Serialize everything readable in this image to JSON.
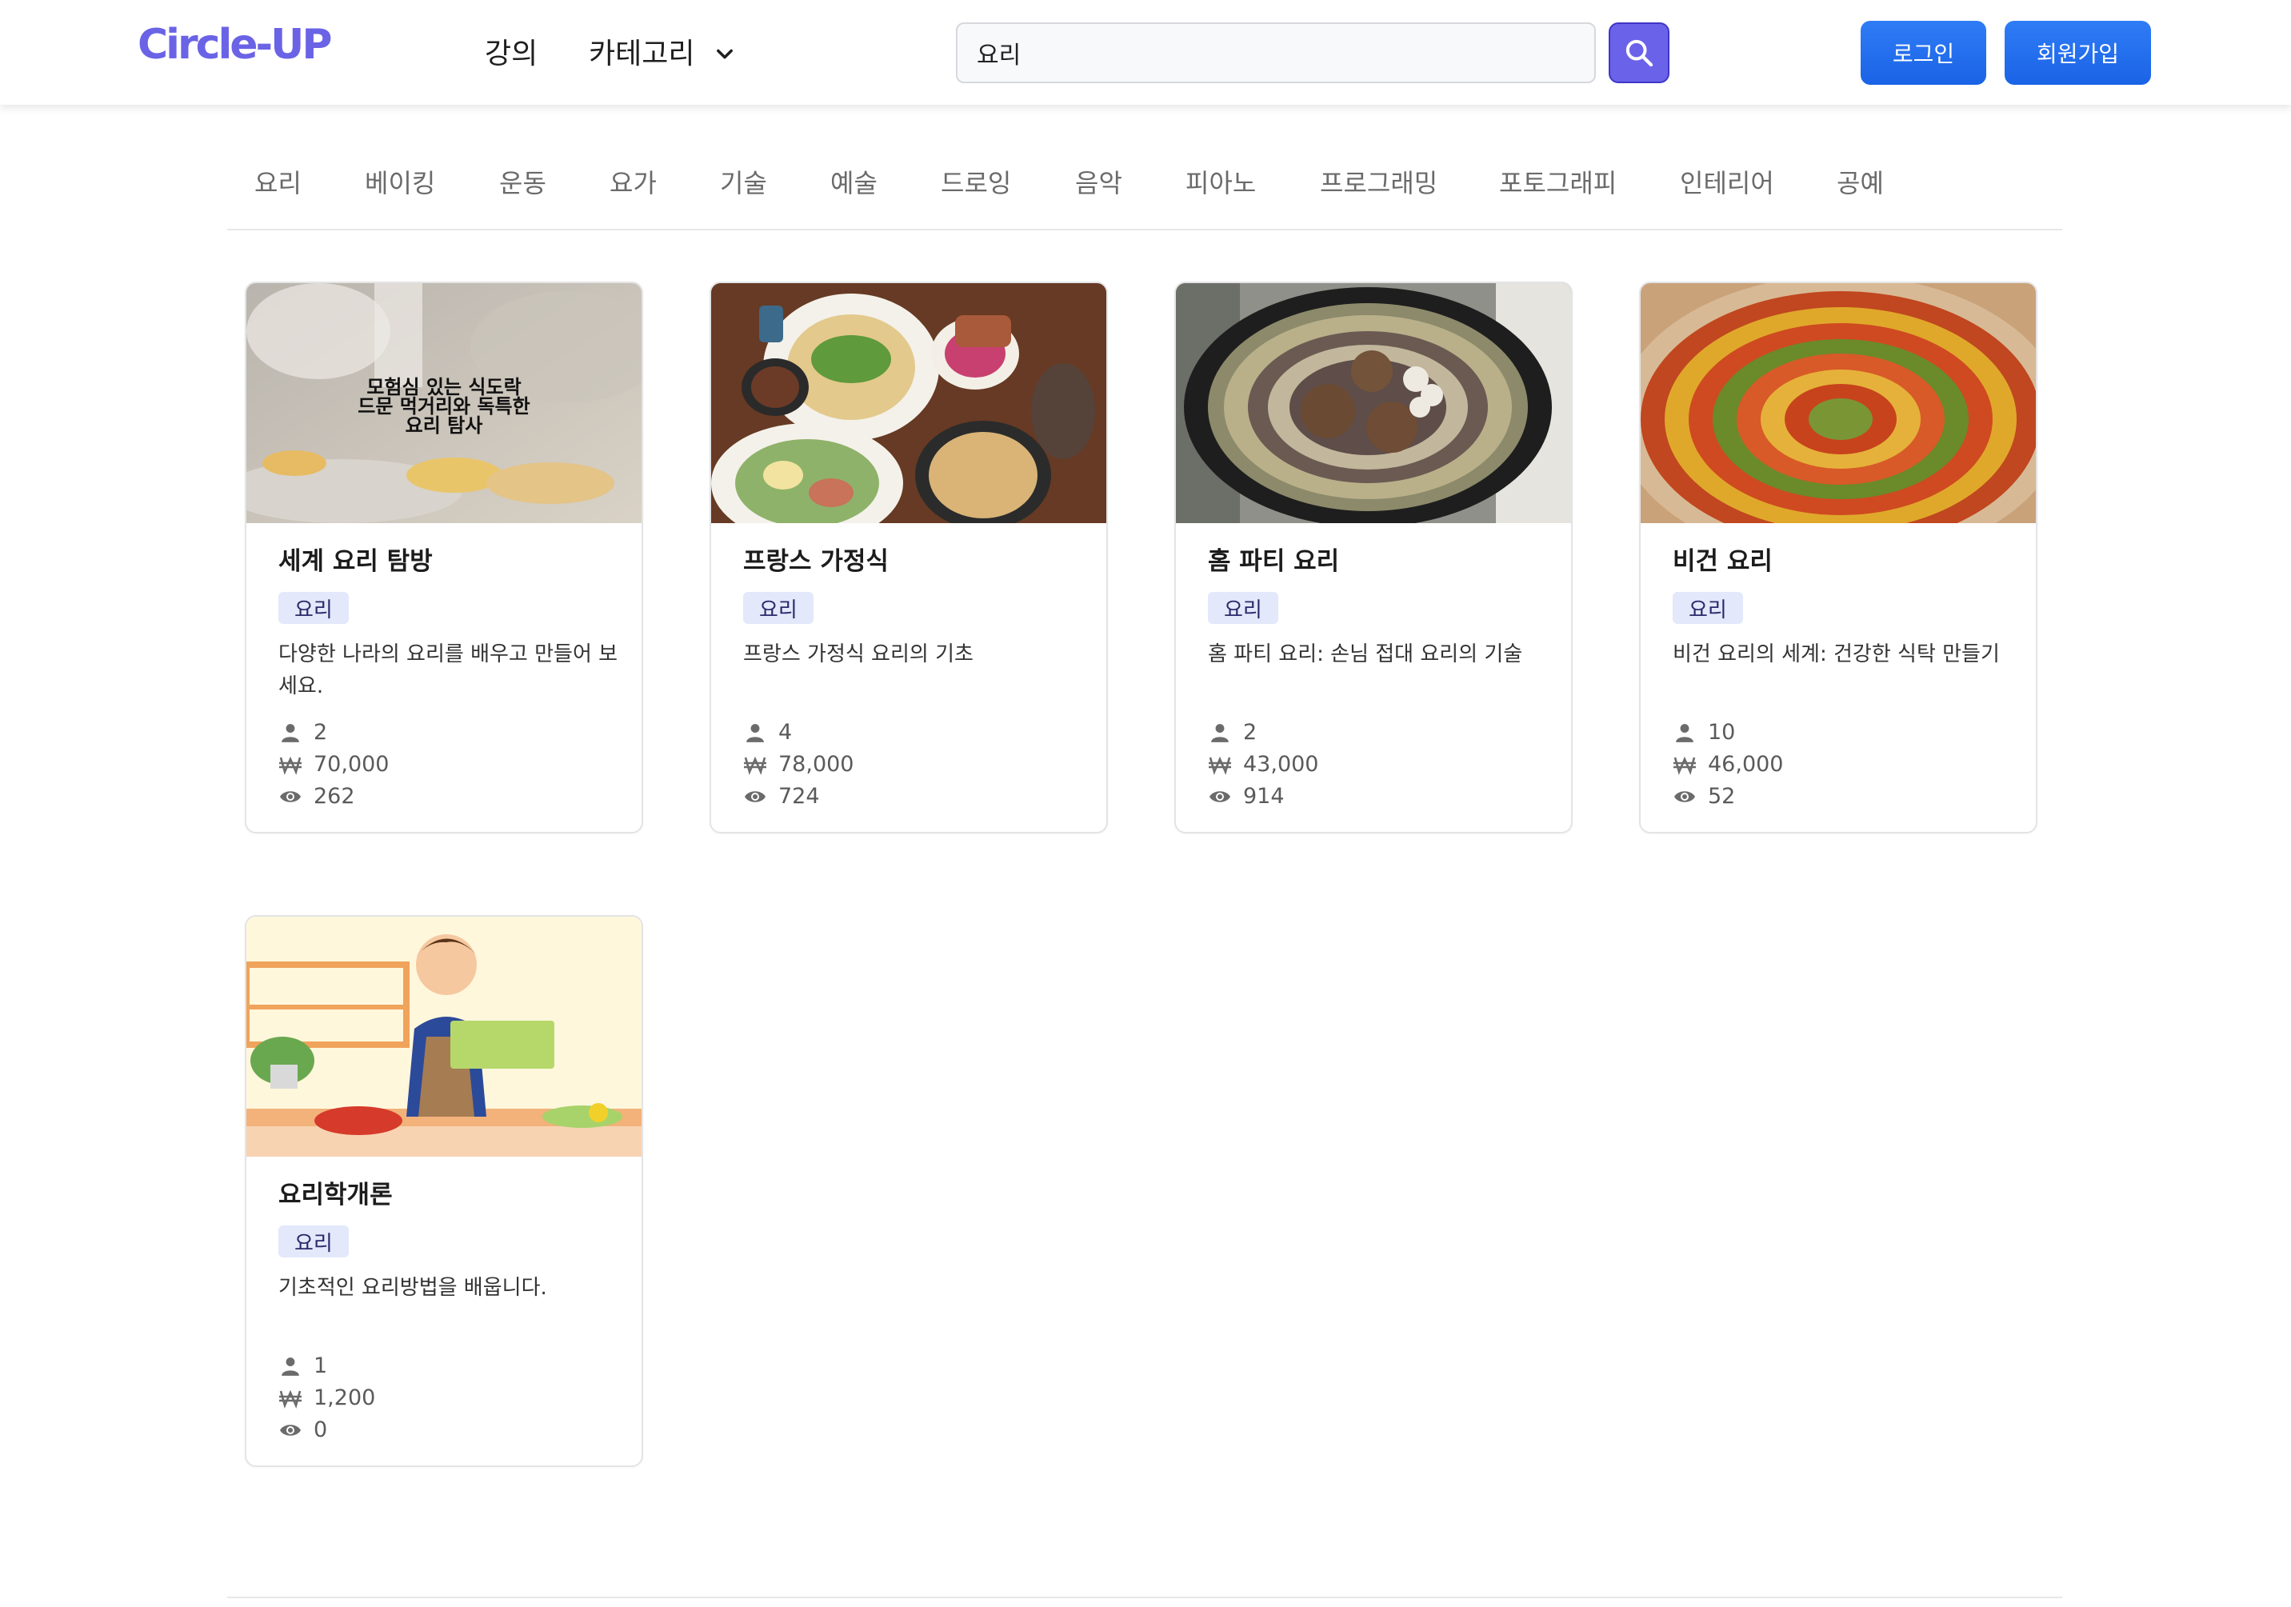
{
  "header": {
    "logo": "Circle-UP",
    "nav": {
      "lecture": "강의",
      "category": "카테고리"
    },
    "search": {
      "value": "요리"
    },
    "login": "로그인",
    "signup": "회원가입"
  },
  "categories": [
    "요리",
    "베이킹",
    "운동",
    "요가",
    "기술",
    "예술",
    "드로잉",
    "음악",
    "피아노",
    "프로그래밍",
    "포토그래피",
    "인테리어",
    "공예"
  ],
  "courses": [
    {
      "title": "세계 요리 탐방",
      "category": "요리",
      "description": "다양한 나라의 요리를 배우고 만들어 보세요.",
      "thumb_caption": [
        "모험심 있는 식도락",
        "드문 먹거리와 독특한",
        "요리 탐사"
      ],
      "students": "2",
      "price": "70,000",
      "views": "262"
    },
    {
      "title": "프랑스 가정식",
      "category": "요리",
      "description": "프랑스 가정식 요리의 기초",
      "students": "4",
      "price": "78,000",
      "views": "724"
    },
    {
      "title": "홈 파티 요리",
      "category": "요리",
      "description": "홈 파티 요리: 손님 접대 요리의 기술",
      "students": "2",
      "price": "43,000",
      "views": "914"
    },
    {
      "title": "비건 요리",
      "category": "요리",
      "description": "비건 요리의 세계: 건강한 식탁 만들기",
      "students": "10",
      "price": "46,000",
      "views": "52"
    },
    {
      "title": "요리학개론",
      "category": "요리",
      "description": "기초적인 요리방법을 배웁니다.",
      "students": "1",
      "price": "1,200",
      "views": "0"
    }
  ],
  "icons": {
    "students": "user-icon",
    "price": "won-icon",
    "views": "eye-icon",
    "search": "search-icon",
    "dropdown": "chevron-down-icon"
  },
  "colors": {
    "brand": "#6a63e6",
    "primary_button": "#1f6cf0",
    "search_button": "#6b62ea",
    "badge_bg": "#e3e8fb"
  }
}
